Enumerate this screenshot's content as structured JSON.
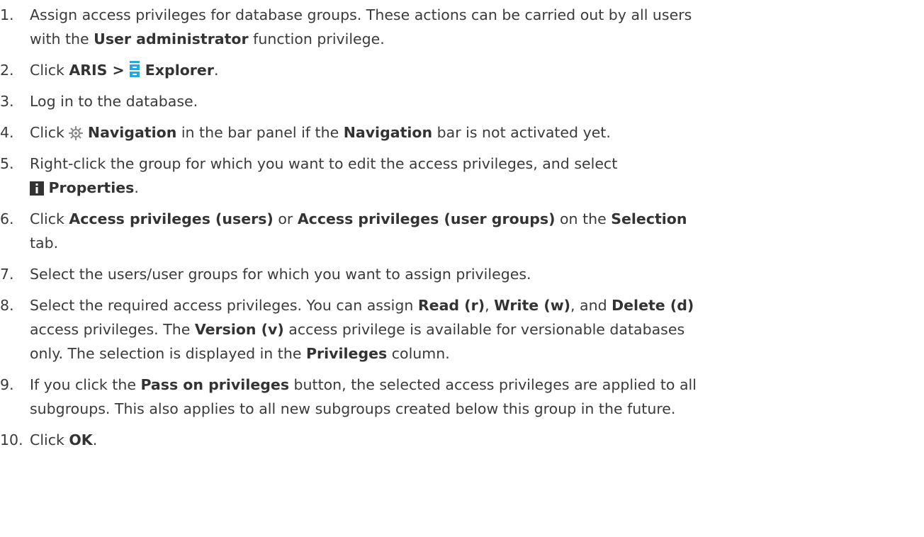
{
  "steps": [
    {
      "num": "1.",
      "t1": "Assign access privileges for database groups. These actions can be carried out by all users",
      "t2": "with the ",
      "b1": "User administrator",
      "t3": " function privilege."
    },
    {
      "num": "2.",
      "t1": "Click ",
      "b1": "ARIS >",
      "b2": "Explorer",
      "t2": "."
    },
    {
      "num": "3.",
      "t1": "Log in to the database."
    },
    {
      "num": "4.",
      "t1": "Click ",
      "b1": "Navigation",
      "t2": " in the bar panel if the ",
      "b2": "Navigation",
      "t3": " bar is not activated yet."
    },
    {
      "num": "5.",
      "t1": "Right-click the group for which you want to edit the access privileges, and select",
      "b1": "Properties",
      "t2": "."
    },
    {
      "num": "6.",
      "t1": "Click ",
      "b1": "Access privileges (users)",
      "t2": " or ",
      "b2": "Access privileges (user groups)",
      "t3": " on the ",
      "b3": "Selection",
      "t4": "tab."
    },
    {
      "num": "7.",
      "t1": "Select the users/user groups for which you want to assign privileges."
    },
    {
      "num": "8.",
      "t1": "Select the required access privileges. You can assign ",
      "b1": "Read (r)",
      "t2": ", ",
      "b2": "Write (w)",
      "t3": ", and ",
      "b3": "Delete (d)",
      "t4": "access privileges. The ",
      "b4": "Version (v)",
      "t5": " access privilege is available for versionable databases",
      "t6": "only. The selection is displayed in the ",
      "b5": "Privileges",
      "t7": " column."
    },
    {
      "num": "9.",
      "t1": "If you click the ",
      "b1": "Pass on privileges",
      "t2": " button, the selected access privileges are applied to all",
      "t3": "subgroups. This also applies to all new subgroups created below this group in the future."
    },
    {
      "num": "10.",
      "t1": "Click ",
      "b1": "OK",
      "t2": "."
    }
  ],
  "icons": {
    "explorer": "explorer-icon",
    "navigation": "navigation-icon",
    "properties": "properties-icon"
  },
  "colors": {
    "explorer_icon": "#29a8e0",
    "properties_icon": "#333333",
    "navigation_icon": "#8a8a8a"
  }
}
